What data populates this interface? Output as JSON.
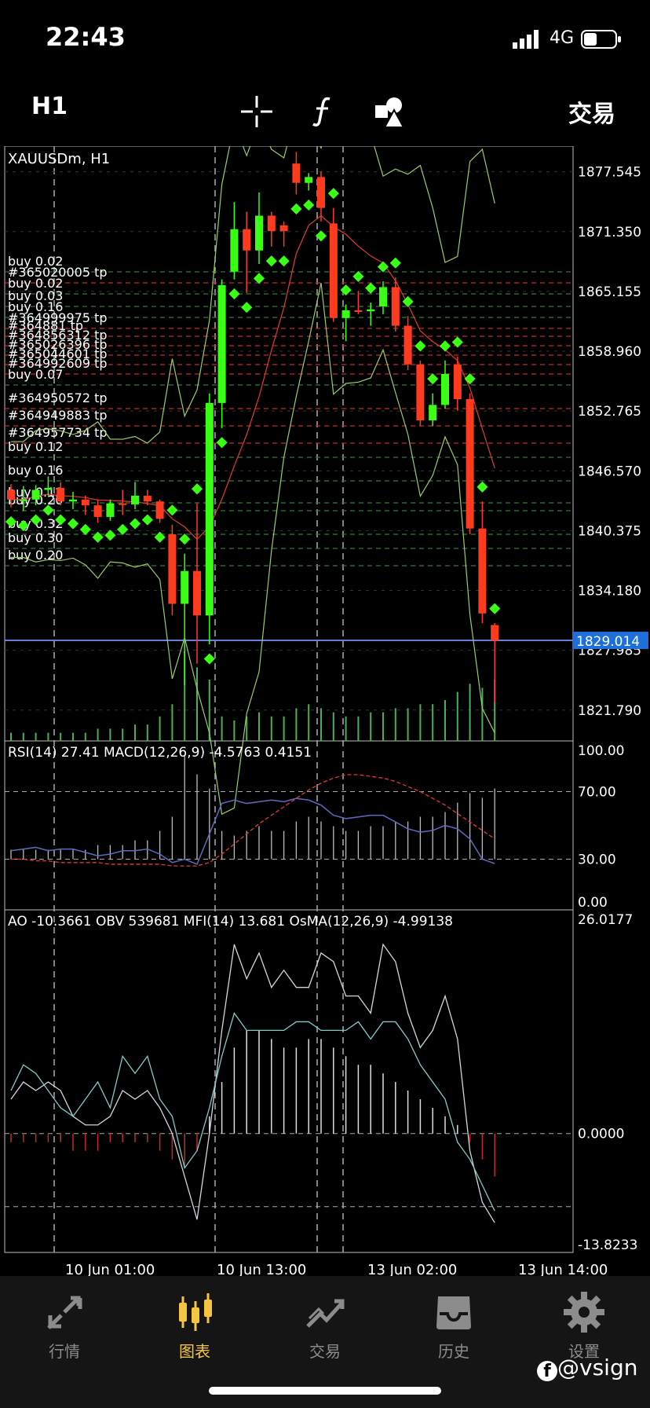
{
  "status_bar": {
    "time": "22:43",
    "network": "4G"
  },
  "toolbar": {
    "timeframe": "H1",
    "trade_label": "交易",
    "icons": [
      "crosshair-icon",
      "function-icon",
      "shapes-icon"
    ]
  },
  "chart": {
    "symbol_label": "XAUUSDm, H1",
    "price_labels": [
      "1877.545",
      "1871.350",
      "1865.155",
      "1858.960",
      "1852.765",
      "1846.570",
      "1840.375",
      "1834.180",
      "1827.985",
      "1821.790"
    ],
    "current_price": "1829.014",
    "order_labels": [
      "buy 0.02",
      "#365020005 tp",
      "buy 0.02",
      "buy 0.03",
      "buy 0.16",
      "#364999975 tp",
      "#364881 tp",
      "#364856312 tp",
      "#365026396 tp",
      "#365044601 tp",
      "#364992609 tp",
      "buy 0.07",
      "#364950572 tp",
      "#364949883 tp",
      "#364957734 tp",
      "buy 0.12",
      "buy 0.16",
      "buy 0.12",
      "buy 0.20",
      "buy 0.32",
      "buy 0.30",
      "buy 0.20"
    ],
    "panel2_label": "RSI(14) 27.41 MACD(12,26,9) -4.5763 0.4151",
    "panel2_levels": [
      "100.00",
      "70.00",
      "30.00",
      "0.00"
    ],
    "panel3_label": "AO -10.3661 OBV 539681 MFI(14) 13.681 OsMA(12,26,9) -4.99138",
    "panel3_levels": [
      "26.0177",
      "0.0000",
      "-13.8233"
    ],
    "time_labels": [
      "10 Jun 01:00",
      "10 Jun 13:00",
      "13 Jun 02:00",
      "13 Jun 14:00"
    ]
  },
  "chart_data": {
    "type": "candlestick",
    "symbol": "XAUUSDm",
    "timeframe": "H1",
    "candles": [
      {
        "o": 1844.6,
        "c": 1843.6,
        "h": 1845.2,
        "l": 1842.8
      },
      {
        "o": 1843.6,
        "c": 1843.6,
        "h": 1845.0,
        "l": 1842.4
      },
      {
        "o": 1843.6,
        "c": 1844.6,
        "h": 1845.1,
        "l": 1843.0
      },
      {
        "o": 1844.6,
        "c": 1844.8,
        "h": 1846.0,
        "l": 1844.0
      },
      {
        "o": 1844.8,
        "c": 1843.4,
        "h": 1845.4,
        "l": 1843.0
      },
      {
        "o": 1843.4,
        "c": 1843.6,
        "h": 1844.4,
        "l": 1842.6
      },
      {
        "o": 1843.6,
        "c": 1843.0,
        "h": 1844.0,
        "l": 1842.0
      },
      {
        "o": 1843.0,
        "c": 1841.8,
        "h": 1843.6,
        "l": 1841.2
      },
      {
        "o": 1841.8,
        "c": 1843.2,
        "h": 1843.6,
        "l": 1841.4
      },
      {
        "o": 1843.2,
        "c": 1843.1,
        "h": 1844.6,
        "l": 1842.0
      },
      {
        "o": 1843.1,
        "c": 1844.0,
        "h": 1845.4,
        "l": 1842.6
      },
      {
        "o": 1844.0,
        "c": 1843.4,
        "h": 1844.6,
        "l": 1843.0
      },
      {
        "o": 1843.4,
        "c": 1841.6,
        "h": 1843.6,
        "l": 1841.2
      },
      {
        "o": 1840.0,
        "c": 1832.8,
        "h": 1841.0,
        "l": 1831.6
      },
      {
        "o": 1832.8,
        "c": 1836.2,
        "h": 1838.0,
        "l": 1824.4
      },
      {
        "o": 1836.2,
        "c": 1831.6,
        "h": 1843.2,
        "l": 1826.6
      },
      {
        "o": 1831.6,
        "c": 1853.6,
        "h": 1854.6,
        "l": 1828.6
      },
      {
        "o": 1853.6,
        "c": 1865.8,
        "h": 1866.4,
        "l": 1851.0
      },
      {
        "o": 1867.2,
        "c": 1871.6,
        "h": 1874.4,
        "l": 1866.4
      },
      {
        "o": 1871.6,
        "c": 1869.4,
        "h": 1873.4,
        "l": 1865.0
      },
      {
        "o": 1869.4,
        "c": 1873.0,
        "h": 1875.4,
        "l": 1868.0
      },
      {
        "o": 1873.0,
        "c": 1871.4,
        "h": 1873.4,
        "l": 1869.8
      },
      {
        "o": 1872.0,
        "c": 1871.4,
        "h": 1872.4,
        "l": 1869.8
      },
      {
        "o": 1878.4,
        "c": 1876.4,
        "h": 1879.6,
        "l": 1875.2
      },
      {
        "o": 1876.4,
        "c": 1877.0,
        "h": 1877.4,
        "l": 1875.6
      },
      {
        "o": 1877.0,
        "c": 1873.8,
        "h": 1877.6,
        "l": 1872.4
      },
      {
        "o": 1872.2,
        "c": 1862.4,
        "h": 1873.8,
        "l": 1862.0
      },
      {
        "o": 1862.4,
        "c": 1863.2,
        "h": 1863.8,
        "l": 1860.0
      },
      {
        "o": 1863.2,
        "c": 1863.1,
        "h": 1865.2,
        "l": 1862.8
      },
      {
        "o": 1863.1,
        "c": 1863.3,
        "h": 1864.0,
        "l": 1861.6
      },
      {
        "o": 1863.6,
        "c": 1865.6,
        "h": 1866.2,
        "l": 1862.8
      },
      {
        "o": 1865.6,
        "c": 1861.6,
        "h": 1866.6,
        "l": 1861.0
      },
      {
        "o": 1861.6,
        "c": 1857.6,
        "h": 1862.6,
        "l": 1857.0
      },
      {
        "o": 1857.6,
        "c": 1851.8,
        "h": 1858.0,
        "l": 1851.2
      },
      {
        "o": 1851.8,
        "c": 1853.4,
        "h": 1854.6,
        "l": 1851.2
      },
      {
        "o": 1853.4,
        "c": 1856.6,
        "h": 1858.0,
        "l": 1853.0
      },
      {
        "o": 1857.6,
        "c": 1854.0,
        "h": 1858.4,
        "l": 1852.8
      },
      {
        "o": 1854.0,
        "c": 1840.6,
        "h": 1854.6,
        "l": 1840.0
      },
      {
        "o": 1840.6,
        "c": 1831.8,
        "h": 1843.4,
        "l": 1830.8
      },
      {
        "o": 1830.6,
        "c": 1829.0,
        "h": 1830.8,
        "l": 1822.6
      }
    ],
    "ylim": [
      1818.6,
      1880.2
    ],
    "current_price": 1829.014,
    "rsi": [
      35,
      36,
      37,
      35,
      36,
      36,
      34,
      32,
      33,
      35,
      35,
      36,
      33,
      28,
      30,
      27,
      45,
      63,
      65,
      63,
      64,
      65,
      64,
      66,
      65,
      62,
      56,
      54,
      55,
      56,
      56,
      52,
      48,
      46,
      47,
      50,
      48,
      42,
      30,
      27.41
    ],
    "macd_signal": [
      30,
      30,
      29,
      29,
      28,
      28,
      28,
      28,
      27,
      27,
      27,
      27,
      27,
      26,
      26,
      26,
      28,
      33,
      39,
      45,
      51,
      56,
      61,
      66,
      71,
      75,
      78,
      80,
      80,
      79,
      78,
      76,
      73,
      70,
      66,
      62,
      57,
      52,
      47,
      42
    ],
    "volume": [
      2,
      2,
      2,
      2,
      2,
      2,
      2,
      3,
      3,
      3,
      4,
      4,
      6,
      9,
      22,
      18,
      15,
      6,
      5,
      6,
      7,
      6,
      6,
      8,
      9,
      8,
      7,
      6,
      6,
      7,
      7,
      8,
      8,
      9,
      9,
      10,
      12,
      14,
      13,
      15
    ],
    "rsi_ylim": [
      0,
      100
    ],
    "osc_ylim": [
      -13.8233,
      26.0177
    ],
    "ao_line": [
      4,
      6,
      5,
      6,
      5,
      2,
      1,
      1,
      2,
      5,
      4,
      5,
      3,
      0,
      -5,
      -10,
      0,
      12,
      22,
      18,
      21,
      17,
      19,
      17,
      17,
      21,
      20,
      16,
      16,
      14,
      22,
      20,
      14,
      10,
      12,
      16,
      11,
      -2,
      -8,
      -10.3661
    ],
    "mfi_line": [
      5,
      8,
      7,
      5,
      3,
      2,
      4,
      6,
      3,
      9,
      7,
      9,
      4,
      2,
      -4,
      -2,
      3,
      9,
      14,
      12,
      12,
      12,
      12,
      13,
      13,
      12,
      12,
      12,
      13,
      11,
      13,
      13,
      11,
      8,
      6,
      4,
      -1,
      -3,
      -6,
      -9
    ],
    "osma": [
      -1,
      -1,
      -1,
      -1,
      -1,
      -2,
      -2,
      -2,
      -1,
      -1,
      -1,
      -1,
      -2,
      -3,
      -4,
      -2,
      2,
      6,
      10,
      12,
      12,
      11,
      10,
      10,
      11,
      11,
      10,
      9,
      8,
      8,
      7,
      6,
      5,
      4,
      3,
      2,
      1,
      -1,
      -3,
      -4.99
    ]
  }
}
